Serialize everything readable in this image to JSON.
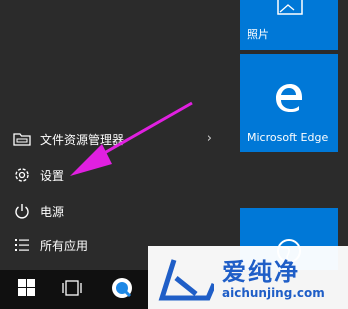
{
  "start_menu": {
    "items": [
      {
        "label": "文件资源管理器",
        "icon": "folder-icon",
        "has_submenu": true
      },
      {
        "label": "设置",
        "icon": "gear-icon"
      },
      {
        "label": "电源",
        "icon": "power-icon"
      },
      {
        "label": "所有应用",
        "icon": "list-icon"
      }
    ]
  },
  "tiles": {
    "photos_label": "照片",
    "edge_label": "Microsoft Edge"
  },
  "watermark": {
    "text": "爱纯净",
    "url": "aichunjing.com"
  },
  "colors": {
    "tile_blue": "#0078d7",
    "menu_bg": "#2b2b2b",
    "taskbar_bg": "#101010",
    "arrow": "#e020e0",
    "watermark_blue": "#1f5ec7"
  }
}
